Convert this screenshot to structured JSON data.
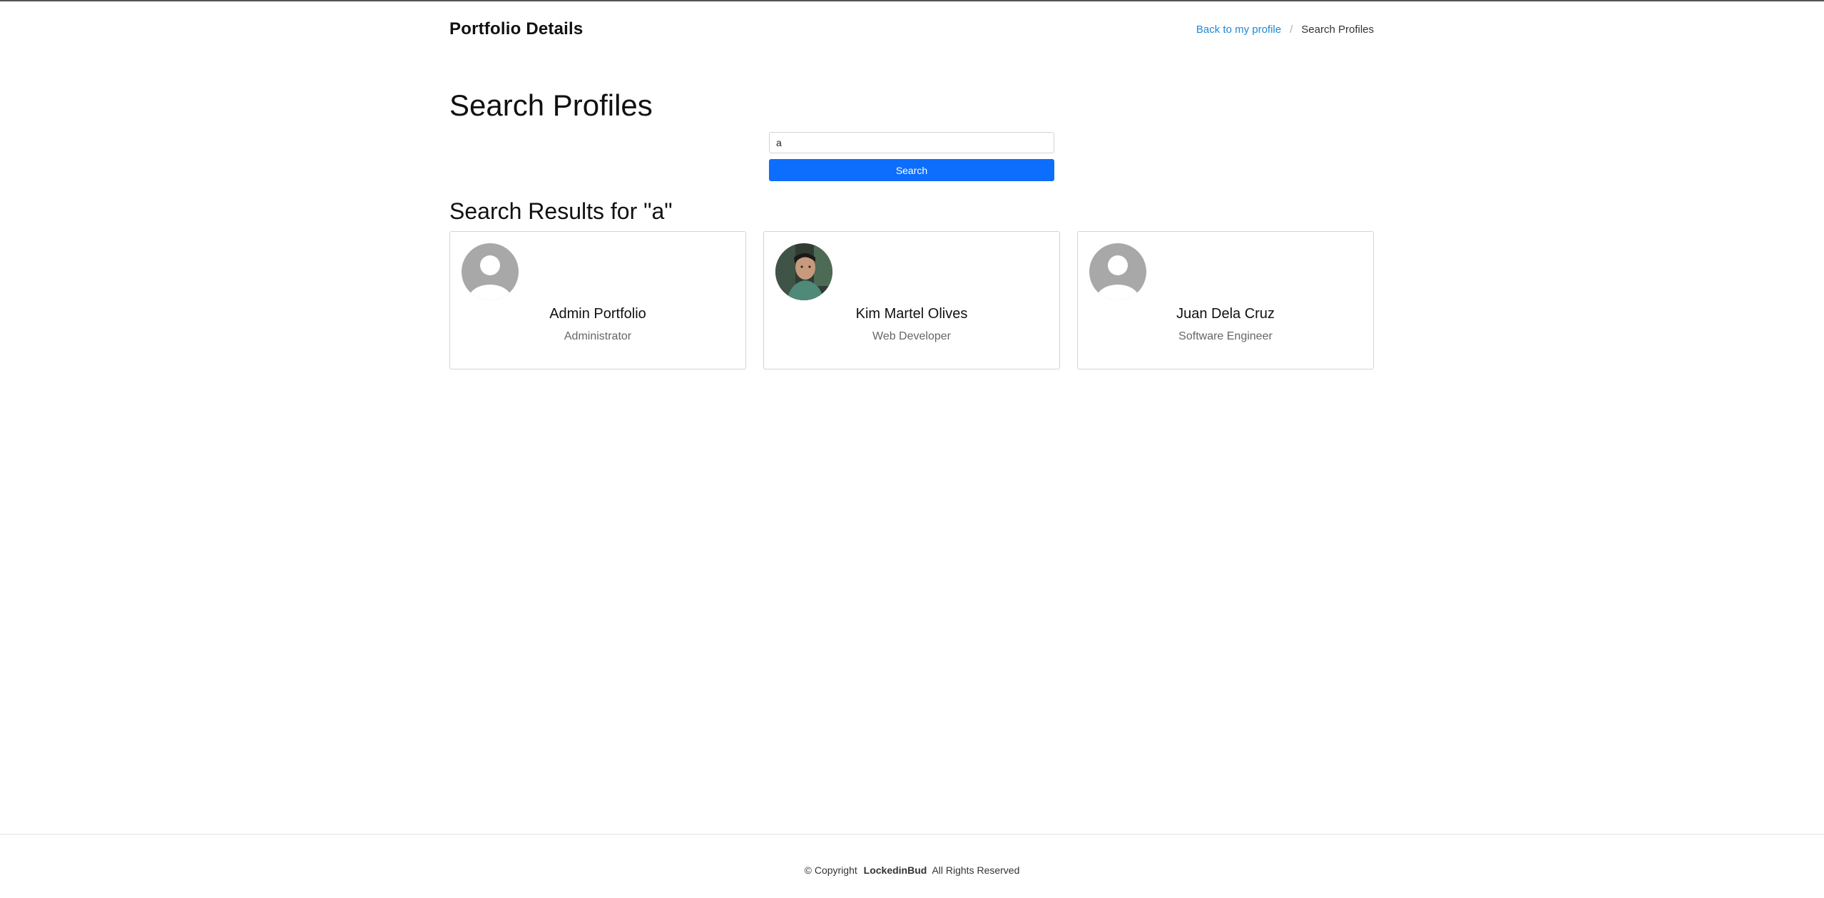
{
  "header": {
    "title": "Portfolio Details",
    "breadcrumb": {
      "link": "Back to my profile",
      "separator": "/",
      "current": "Search Profiles"
    }
  },
  "page": {
    "title": "Search Profiles"
  },
  "search": {
    "value": "a",
    "button_label": "Search"
  },
  "results": {
    "title": "Search Results for \"a\"",
    "profiles": [
      {
        "name": "Admin Portfolio",
        "role": "Administrator",
        "avatar": "default-avatar-icon"
      },
      {
        "name": "Kim Martel Olives",
        "role": "Web Developer",
        "avatar": "profile-photo"
      },
      {
        "name": "Juan Dela Cruz",
        "role": "Software Engineer",
        "avatar": "default-avatar-icon"
      }
    ]
  },
  "footer": {
    "prefix": "© Copyright",
    "brand": "LockedinBud",
    "suffix": "All Rights Reserved"
  },
  "colors": {
    "accent": "#0d6efd",
    "link": "#1e88d6",
    "avatar_bg": "#a8a8a8"
  }
}
